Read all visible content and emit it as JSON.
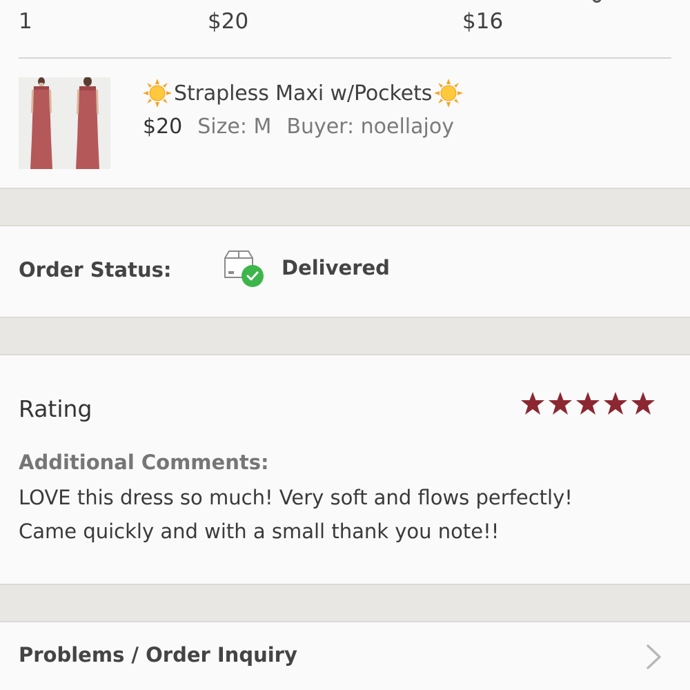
{
  "summary": {
    "quantity": "1",
    "price": "$20",
    "earnings": "$16"
  },
  "product": {
    "title": "Strapless Maxi w/Pockets",
    "title_icon": "sun-emoji",
    "price": "$20",
    "size_label": "Size: M",
    "buyer_label": "Buyer: noellajoy",
    "dress_color": "#b5585a"
  },
  "order_status": {
    "label": "Order Status:",
    "value": "Delivered",
    "icon": "package-delivered-icon",
    "check_color": "#3cb54a"
  },
  "rating": {
    "title": "Rating",
    "stars": 5,
    "max_stars": 5,
    "star_color": "#8c2731",
    "comments_label": "Additional Comments:",
    "comments_line1": "LOVE this dress so much! Very soft and flows perfectly!",
    "comments_line2": "Came quickly and with a small thank you note!!"
  },
  "problems": {
    "label": "Problems / Order Inquiry",
    "icon": "chevron-right-icon"
  }
}
